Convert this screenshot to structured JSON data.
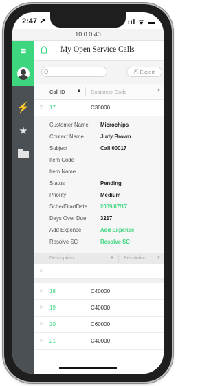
{
  "status_bar": {
    "time": "2:47 ↗",
    "icons": "ııl ᯤ ▬"
  },
  "browser": {
    "url": "10.0.0.40"
  },
  "rail": {
    "items": [
      "menu",
      "user",
      "service-calls",
      "favorites",
      "folders"
    ]
  },
  "header": {
    "title": "My Open Service Calls"
  },
  "toolbar": {
    "search_placeholder": "",
    "export_label": "Export"
  },
  "table": {
    "columns": {
      "call_id": "Call ID",
      "customer_code": "Customer Code"
    },
    "expanded_row": {
      "toggle": "▽",
      "id": "17",
      "code": "C30000"
    },
    "details": [
      {
        "key": "Customer Name",
        "value": "Microchips",
        "green": false
      },
      {
        "key": "Contact Name",
        "value": "Judy Brown",
        "green": false
      },
      {
        "key": "Subject",
        "value": "Call 00017",
        "green": false
      },
      {
        "key": "Item Code",
        "value": "",
        "green": false
      },
      {
        "key": "Item Name",
        "value": "",
        "green": false
      },
      {
        "key": "Status",
        "value": "Pending",
        "green": false
      },
      {
        "key": "Priority",
        "value": "Medium",
        "green": false
      },
      {
        "key": "SchedStartDate",
        "value": "2009/07/17",
        "green": true
      },
      {
        "key": "Days Over Due",
        "value": "3217",
        "green": false
      },
      {
        "key": "Add Expense",
        "value": "Add Expense",
        "green": true
      },
      {
        "key": "Resolve SC",
        "value": "Resolve SC",
        "green": true
      }
    ],
    "sub_columns": {
      "description": "Description",
      "resolution": "Resolution"
    },
    "rows": [
      {
        "toggle": "▷",
        "id": "18",
        "code": "C40000"
      },
      {
        "toggle": "▷",
        "id": "19",
        "code": "C40000"
      },
      {
        "toggle": "▷",
        "id": "20",
        "code": "C60000"
      },
      {
        "toggle": "▷",
        "id": "21",
        "code": "C40000"
      }
    ]
  },
  "colors": {
    "accent": "#3dd67f",
    "rail": "#4a5054"
  }
}
